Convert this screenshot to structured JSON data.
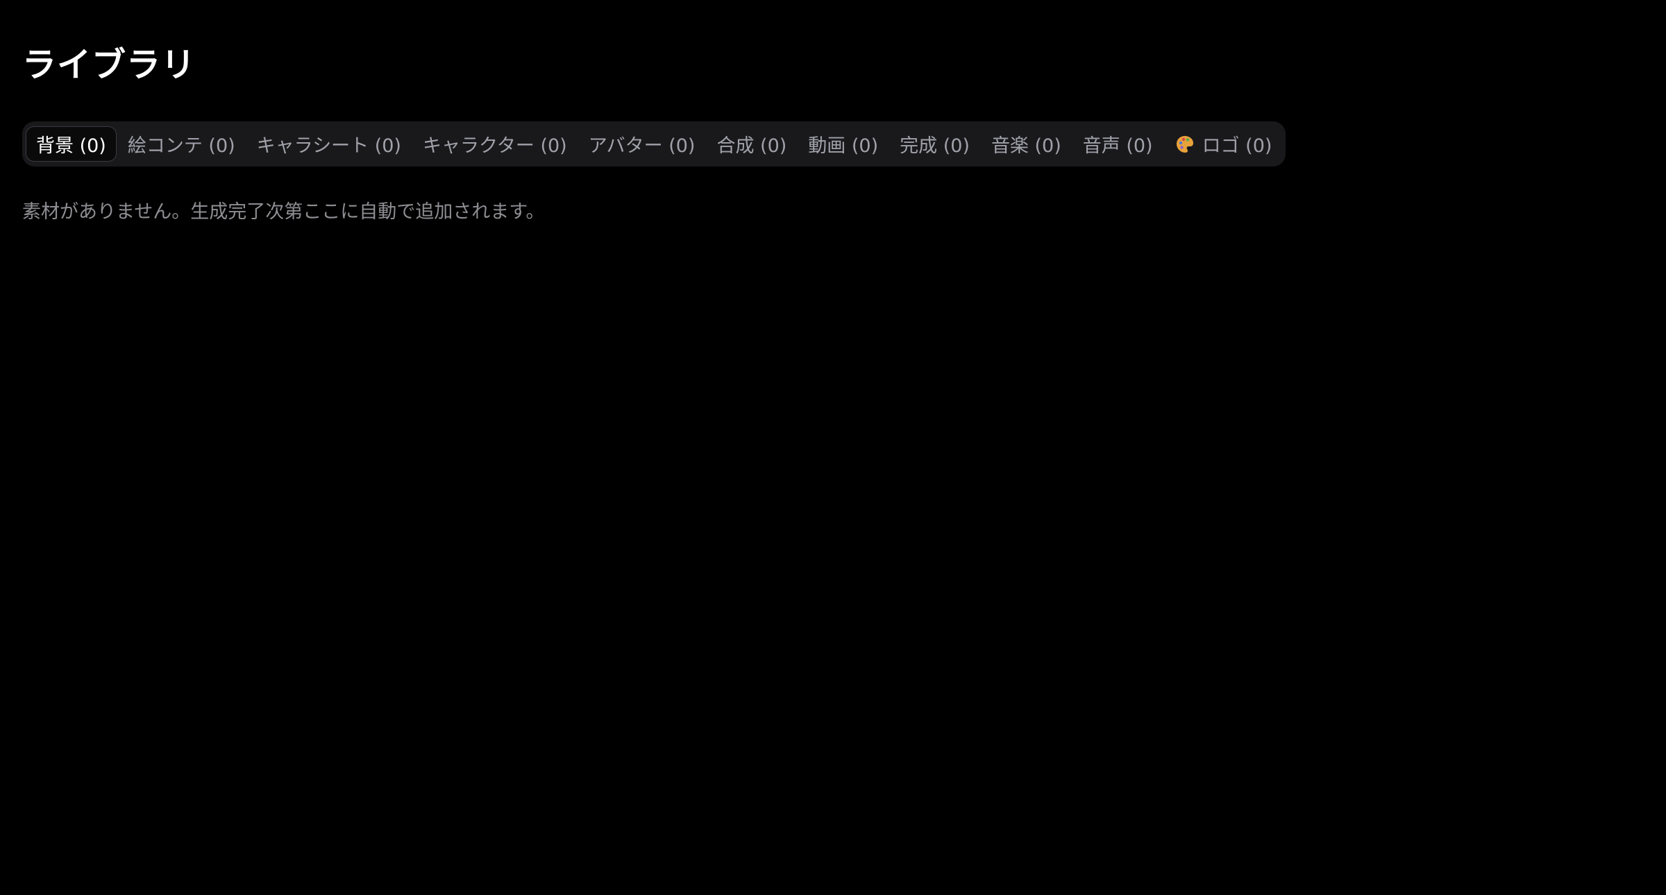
{
  "page": {
    "title": "ライブラリ"
  },
  "tabs": [
    {
      "label": "背景 (0)",
      "active": true
    },
    {
      "label": "絵コンテ (0)",
      "active": false
    },
    {
      "label": "キャラシート (0)",
      "active": false
    },
    {
      "label": "キャラクター (0)",
      "active": false
    },
    {
      "label": "アバター (0)",
      "active": false
    },
    {
      "label": "合成 (0)",
      "active": false
    },
    {
      "label": "動画 (0)",
      "active": false
    },
    {
      "label": "完成 (0)",
      "active": false
    },
    {
      "label": "音楽 (0)",
      "active": false
    },
    {
      "label": "音声 (0)",
      "active": false
    },
    {
      "label": "ロゴ (0)",
      "active": false,
      "icon": "palette-icon"
    }
  ],
  "empty_state": {
    "message": "素材がありません。生成完了次第ここに自動で追加されます。"
  },
  "colors": {
    "background": "#000000",
    "tab_bar": "#19191c",
    "active_tab": "#0a0a0b",
    "inactive_text": "#a1a1aa",
    "palette_icon": "#e8a23a"
  }
}
